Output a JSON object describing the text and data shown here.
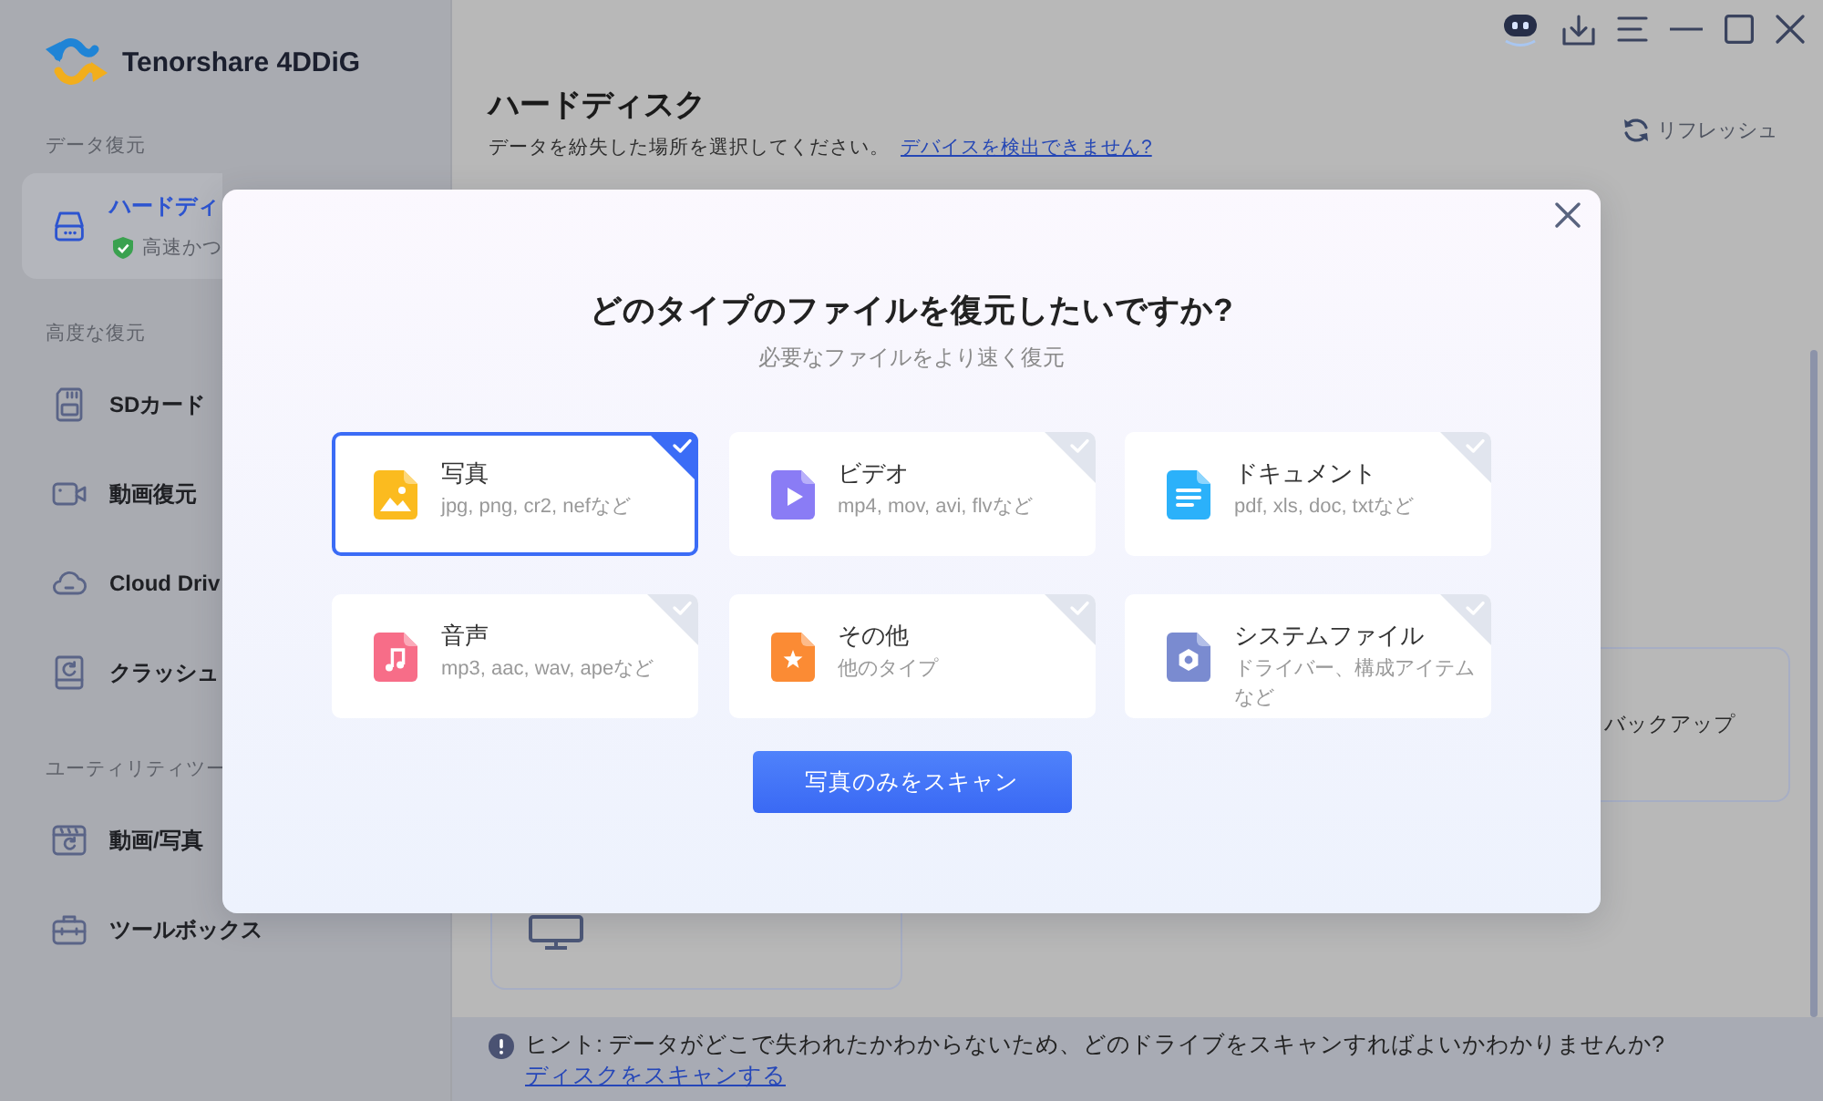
{
  "app": {
    "name": "Tenorshare 4DDiG"
  },
  "sidebar": {
    "sections": [
      {
        "heading": "データ復元",
        "items": [
          {
            "kind": "harddisk",
            "label": "ハードディ",
            "note": "高速かつ",
            "selected": true
          }
        ]
      },
      {
        "heading": "高度な復元",
        "items": [
          {
            "kind": "sd",
            "label": "SDカード",
            "selected": false
          },
          {
            "kind": "video",
            "label": "動画復元",
            "selected": false
          },
          {
            "kind": "cloud",
            "label": "Cloud Driv",
            "selected": false
          },
          {
            "kind": "crash",
            "label": "クラッシュ",
            "selected": false
          }
        ]
      },
      {
        "heading": "ユーティリティツー",
        "items": [
          {
            "kind": "repair",
            "label": "動画/写真",
            "selected": false
          },
          {
            "kind": "toolbox",
            "label": "ツールボックス",
            "selected": false
          }
        ]
      }
    ]
  },
  "toolbar": [
    {
      "kind": "assistant"
    },
    {
      "kind": "download"
    },
    {
      "kind": "menu"
    },
    {
      "kind": "minimize"
    },
    {
      "kind": "maximize"
    },
    {
      "kind": "close"
    }
  ],
  "header": {
    "title": "ハードディスク",
    "subtitle": "データを紛失した場所を選択してください。",
    "help_link": "デバイスを検出できません?",
    "refresh": "リフレッシュ"
  },
  "locations": [
    {
      "kind": "backup",
      "label": "バックアップ"
    },
    {
      "kind": "desktop"
    }
  ],
  "hint": {
    "text": "ヒント: データがどこで失われたかわからないため、どのドライブをスキャンすればよいかわかりませんか?",
    "link": "ディスクをスキャンする"
  },
  "dialog": {
    "title": "どのタイプのファイルを復元したいですか?",
    "subtitle": "必要なファイルをより速く復元",
    "file_types": [
      {
        "kind": "photo",
        "title": "写真",
        "desc": "jpg, png, cr2, nefなど",
        "selected": true
      },
      {
        "kind": "video",
        "title": "ビデオ",
        "desc": "mp4, mov, avi, flvなど",
        "selected": false
      },
      {
        "kind": "document",
        "title": "ドキュメント",
        "desc": "pdf, xls, doc, txtなど",
        "selected": false
      },
      {
        "kind": "audio",
        "title": "音声",
        "desc": "mp3, aac, wav, apeなど",
        "selected": false
      },
      {
        "kind": "other",
        "title": "その他",
        "desc": "他のタイプ",
        "selected": false
      },
      {
        "kind": "system",
        "title": "システムファイル",
        "desc": "ドライバー、構成アイテムなど",
        "selected": false
      }
    ],
    "scan_button": "写真のみをスキャン"
  }
}
